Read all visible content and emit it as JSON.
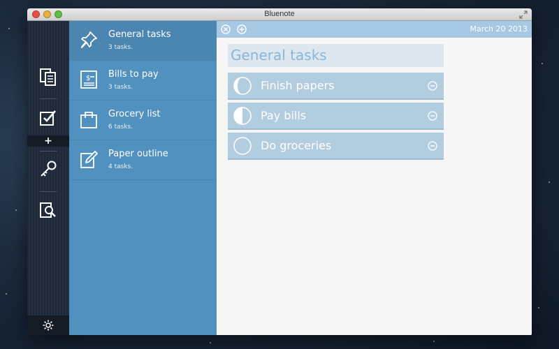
{
  "window": {
    "title": "Bluenote"
  },
  "rail": {
    "items": [
      {
        "name": "notes-icon"
      },
      {
        "name": "tasks-icon"
      },
      {
        "name": "passwords-icon"
      },
      {
        "name": "search-notes-icon"
      }
    ],
    "add_symbol": "+",
    "settings_icon": "gear-icon"
  },
  "lists": [
    {
      "title": "General tasks",
      "count": "3 tasks.",
      "icon": "pin-icon"
    },
    {
      "title": "Bills to pay",
      "count": "3 tasks.",
      "icon": "bill-icon"
    },
    {
      "title": "Grocery list",
      "count": "6 tasks.",
      "icon": "shopping-bag-icon"
    },
    {
      "title": "Paper outline",
      "count": "4 tasks.",
      "icon": "edit-icon"
    }
  ],
  "content": {
    "date": "March 20 2013",
    "list_title": "General tasks",
    "tasks": [
      {
        "label": "Finish papers",
        "progress": 0.75
      },
      {
        "label": "Pay bills",
        "progress": 0.5
      },
      {
        "label": "Do groceries",
        "progress": 0
      }
    ]
  },
  "colors": {
    "rail": "#1f2836",
    "list_panel": "#5191bf",
    "toolbar": "#a6c8e2",
    "task_row": "#b2cce0"
  }
}
